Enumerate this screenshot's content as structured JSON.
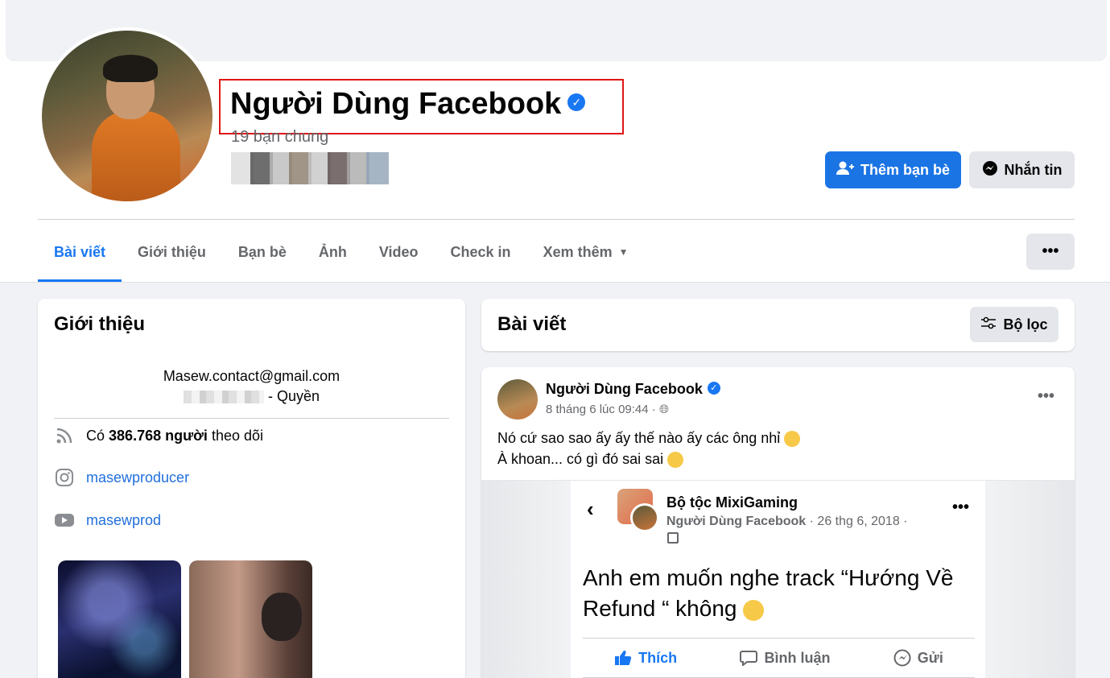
{
  "profile": {
    "name": "Người Dùng Facebook",
    "mutual_friends": "19 bạn chung",
    "add_friend_label": "Thêm bạn bè",
    "message_label": "Nhắn tin",
    "more_label": "•••"
  },
  "tabs": [
    {
      "label": "Bài viết"
    },
    {
      "label": "Giới thiệu"
    },
    {
      "label": "Bạn bè"
    },
    {
      "label": "Ảnh"
    },
    {
      "label": "Video"
    },
    {
      "label": "Check in"
    },
    {
      "label": "Xem thêm"
    }
  ],
  "intro": {
    "title": "Giới thiệu",
    "email": "Masew.contact@gmail.com",
    "line2_suffix": "- Quyền",
    "followers_prefix": "Có",
    "followers_bold": "386.768 người",
    "followers_suffix": "theo dõi",
    "instagram": "masewproducer",
    "youtube": "masewprod"
  },
  "posts_header": {
    "title": "Bài viết",
    "filter_label": "Bộ lọc"
  },
  "post": {
    "author": "Người Dùng Facebook",
    "meta": "8 tháng 6 lúc 09:44 ·",
    "text_line1": "Nó cứ sao sao ấy ấy thế nào ấy các ông nhỉ",
    "text_line2": "À khoan... có gì đó sai sai",
    "menu": "•••"
  },
  "shared": {
    "group_name": "Bộ tộc MixiGaming",
    "poster": "Người Dùng Facebook",
    "date": "· 26 thg 6, 2018 ·",
    "body": "Anh em muốn nghe track “Hướng Về Refund “ không",
    "like": "Thích",
    "comment": "Bình luận",
    "send": "Gửi",
    "menu": "•••"
  },
  "colors": {
    "primary": "#1b74e4",
    "link": "#216fdb",
    "highlight_border": "#e01515"
  }
}
